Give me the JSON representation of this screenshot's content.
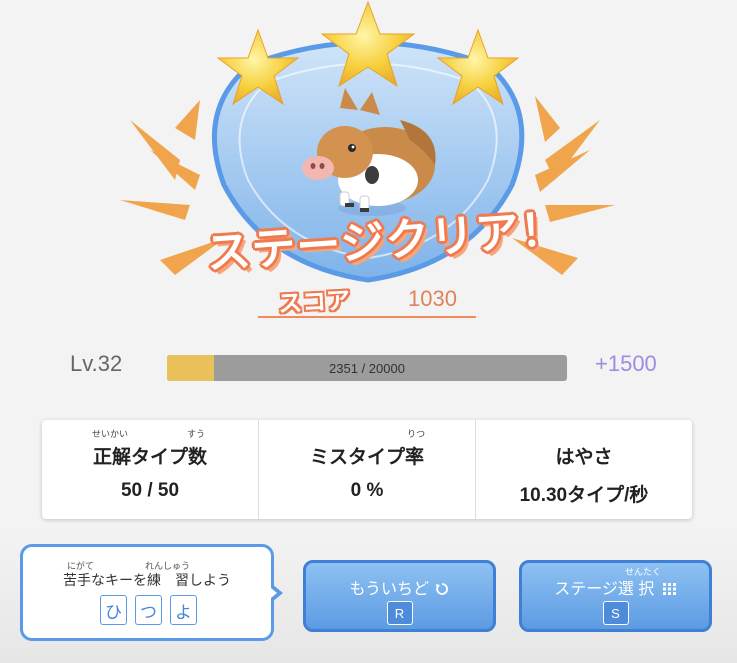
{
  "result": {
    "title": "ステージクリア！",
    "score_label": "スコア",
    "score_value": "1030"
  },
  "level": {
    "label": "Lv.32",
    "progress_text": "2351 / 20000",
    "progress_fraction": 0.1176,
    "gain": "+1500"
  },
  "stats": [
    {
      "title": "正解タイプ数",
      "value": "50 / 50",
      "ruby": [
        {
          "text": "せいかい",
          "over": "正解"
        },
        {
          "text": "すう",
          "over": "数"
        }
      ]
    },
    {
      "title": "ミスタイプ率",
      "value": "0 %",
      "ruby": [
        {
          "text": "りつ",
          "over": "率"
        }
      ]
    },
    {
      "title": "はやさ",
      "value": "10.30タイプ/秒",
      "ruby": []
    }
  ],
  "hint": {
    "text": "苦手なキーを練　習しよう",
    "ruby_nigate": "にがて",
    "ruby_renshuu": "れんしゅう",
    "keys": [
      "ひ",
      "つ",
      "よ"
    ]
  },
  "buttons": {
    "retry": {
      "label": "もういちど",
      "icon": "retry-icon",
      "key": "R"
    },
    "stage_select": {
      "label": "ステージ選 択",
      "ruby": "せんたく",
      "icon": "grid-icon",
      "key": "S"
    }
  },
  "colors": {
    "accent_orange": "#f07a50",
    "level_fill": "#e8c15a",
    "level_track": "#9c9c9c",
    "gain_purple": "#a28be0",
    "button_blue": "#5c9be3"
  }
}
